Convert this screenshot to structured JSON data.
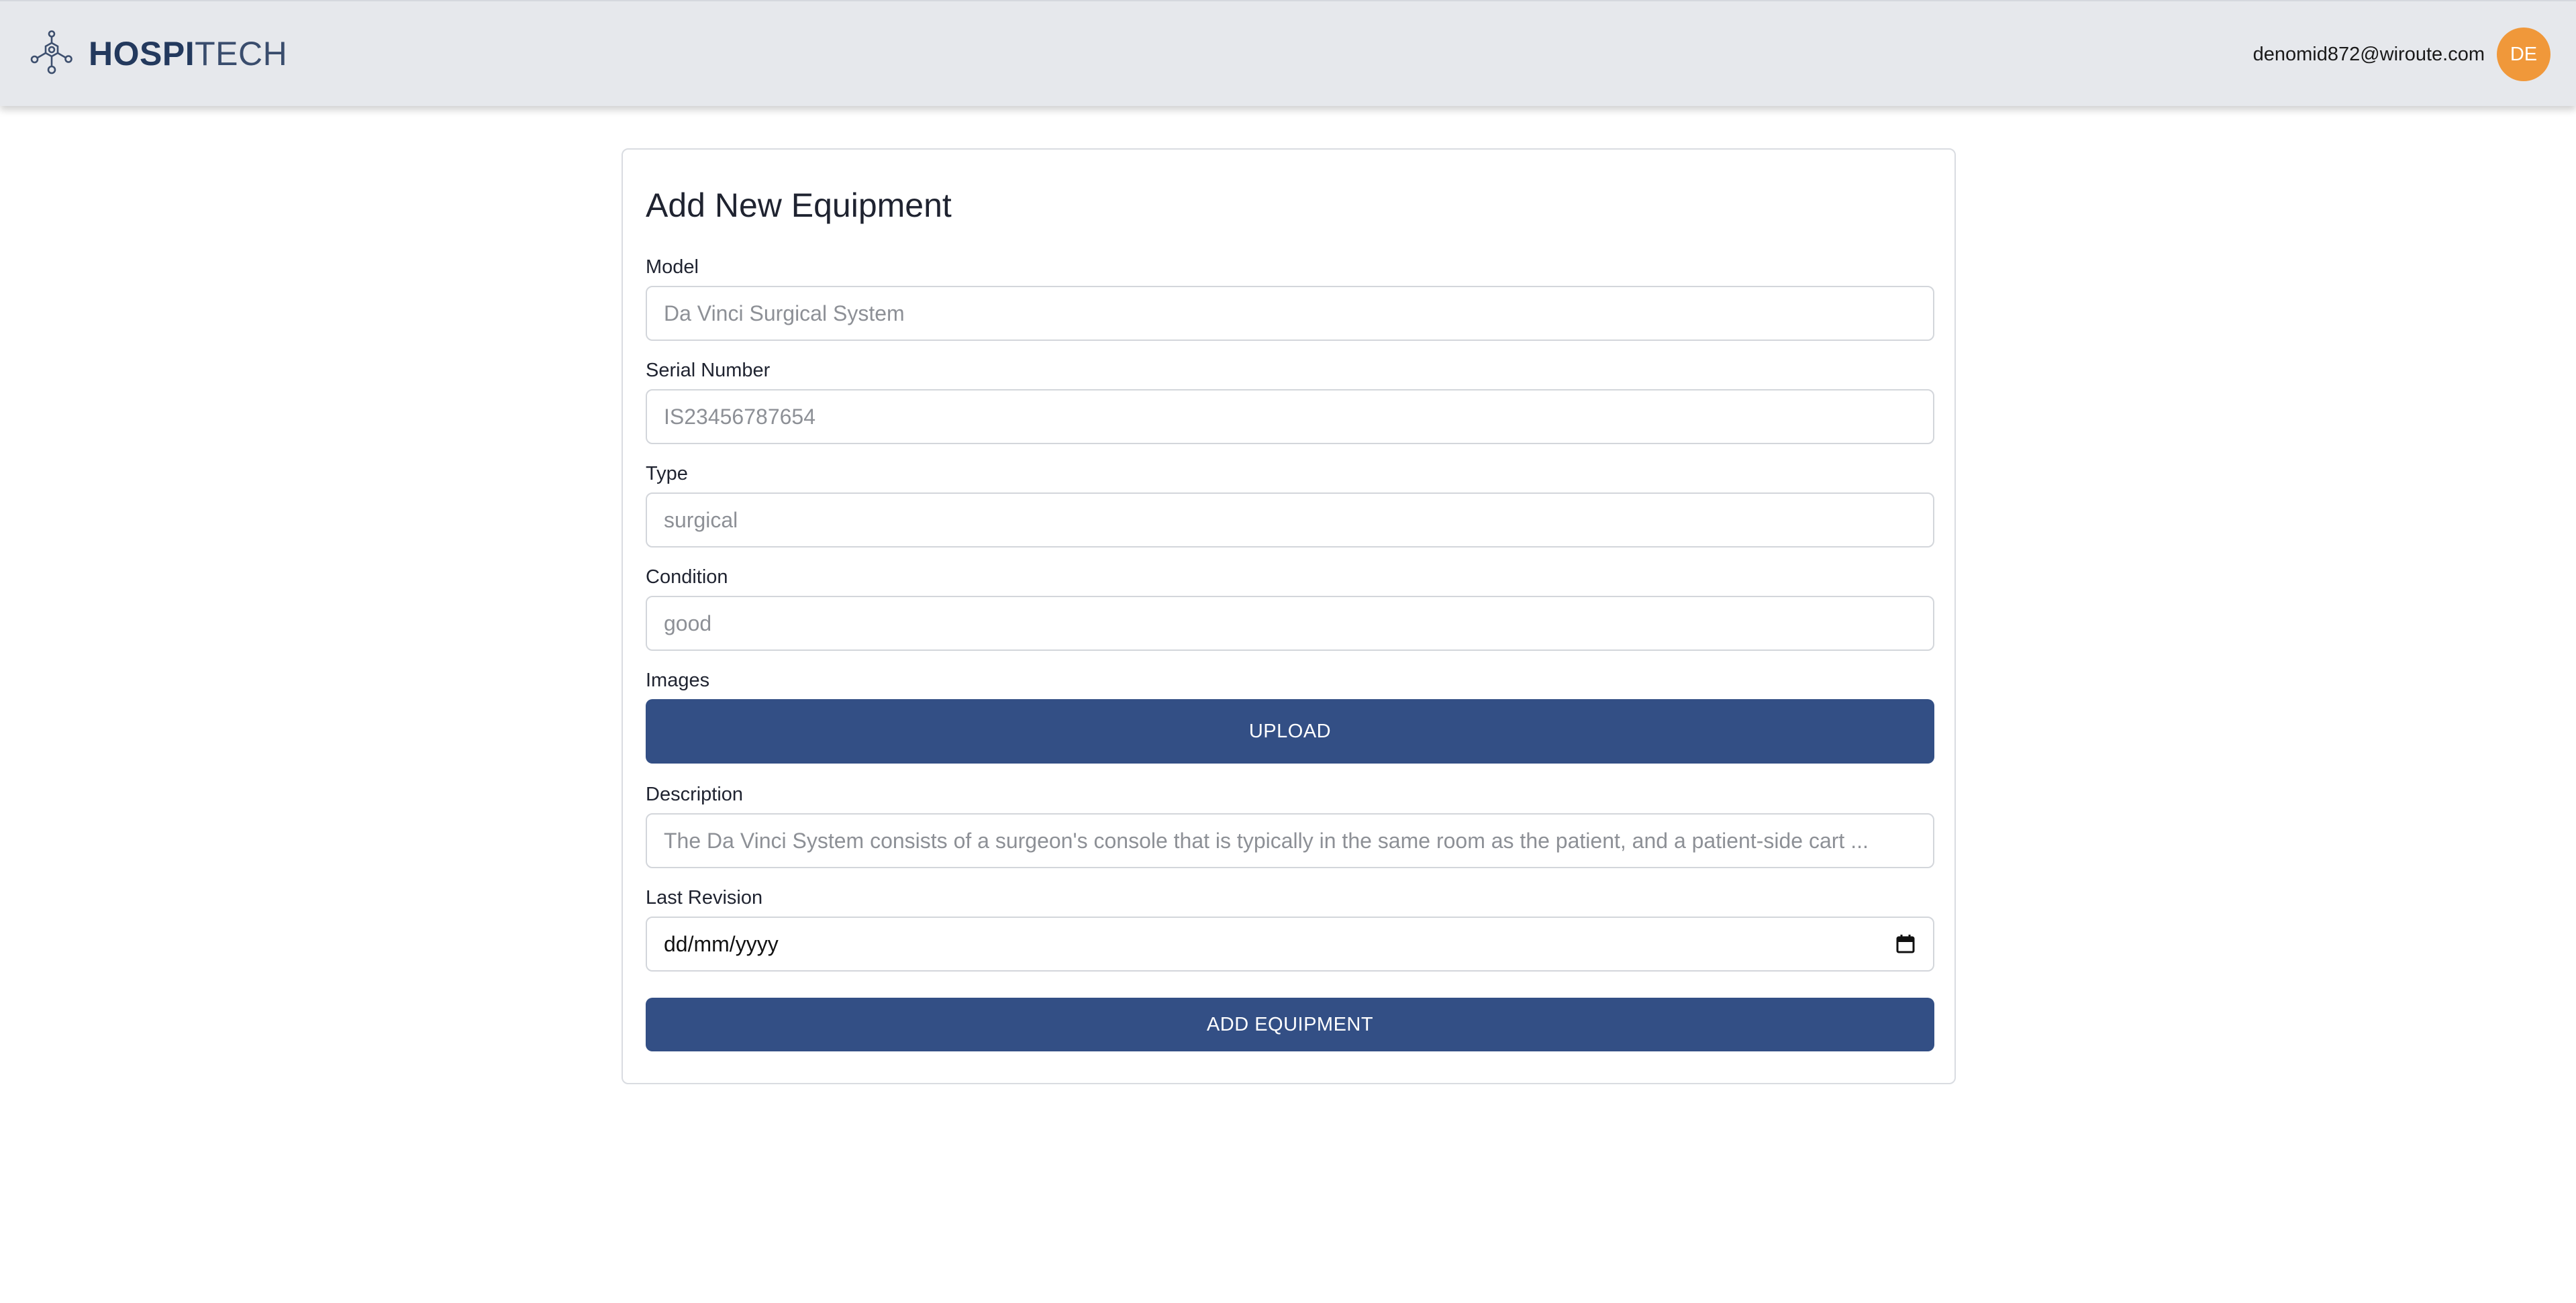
{
  "header": {
    "logo_bold": "HOSPI",
    "logo_light": "TECH",
    "user_email": "denomid872@wiroute.com",
    "avatar_initials": "DE"
  },
  "form": {
    "title": "Add New Equipment",
    "model": {
      "label": "Model",
      "placeholder": "Da Vinci Surgical System"
    },
    "serial": {
      "label": "Serial Number",
      "placeholder": "IS23456787654"
    },
    "type": {
      "label": "Type",
      "placeholder": "surgical"
    },
    "condition": {
      "label": "Condition",
      "placeholder": "good"
    },
    "images": {
      "label": "Images",
      "button_label": "UPLOAD"
    },
    "description": {
      "label": "Description",
      "placeholder": "The Da Vinci System consists of a surgeon's console that is typically in the same room as the patient, and a patient-side cart ..."
    },
    "last_revision": {
      "label": "Last Revision",
      "value": "dd/mm/yyyy"
    },
    "submit_label": "ADD EQUIPMENT"
  },
  "colors": {
    "header_bg": "#e6e8ec",
    "brand_navy": "#23395d",
    "button_bg": "#334f85",
    "avatar_bg": "#f0983a"
  },
  "icons": {
    "logo": "molecule-network-icon",
    "date": "calendar-icon"
  }
}
